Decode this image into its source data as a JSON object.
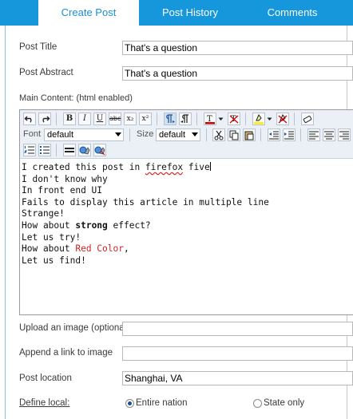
{
  "tabs": [
    {
      "label": "Create Post",
      "active": true
    },
    {
      "label": "Post History",
      "active": false
    },
    {
      "label": "Comments",
      "active": false
    }
  ],
  "form": {
    "post_title_label": "Post Title",
    "post_title_value": "That's a question",
    "post_abstract_label": "Post Abstract",
    "post_abstract_value": "That's a question",
    "main_content_label": "Main Content: (html enabled)",
    "upload_image_label": "Upload an image (optional)",
    "upload_image_value": "",
    "append_link_label": "Append a link to image",
    "append_link_value": "",
    "post_location_label": "Post location",
    "post_location_value": "Shanghai, VA",
    "define_local_label": "Define local:",
    "radio_entire_nation": "Entire nation",
    "radio_state_only": "State only",
    "selected_scope": "Entire nation"
  },
  "toolbar": {
    "undo_icon": "undo-icon",
    "redo_icon": "redo-icon",
    "bold": "B",
    "italic": "I",
    "underline": "U",
    "strike": "abc",
    "subscript": "x₂",
    "superscript": "x²",
    "font_label": "Font",
    "font_value": "default",
    "size_label": "Size",
    "size_value": "default",
    "font_color": "#cc0000",
    "highlight_color": "#ffee00"
  },
  "editor": {
    "lines": [
      {
        "pre": "I created this post in ",
        "misspelled": "firefox",
        "post": " five"
      },
      {
        "text": "I don't know why"
      },
      {
        "text": "In front end UI"
      },
      {
        "text": "Fails to display this article in multiple line"
      },
      {
        "text": "Strange!"
      },
      {
        "pre": "How about ",
        "bold": "strong",
        "post": " effect?"
      },
      {
        "text": "Let us try!"
      },
      {
        "pre": "How about ",
        "red": "Red Color",
        "post": ","
      },
      {
        "text": "Let us find!"
      }
    ]
  },
  "colors": {
    "tab_bar": "#1697dc",
    "active_tab_text": "#1a8fd4",
    "red_text": "#cc2222"
  }
}
